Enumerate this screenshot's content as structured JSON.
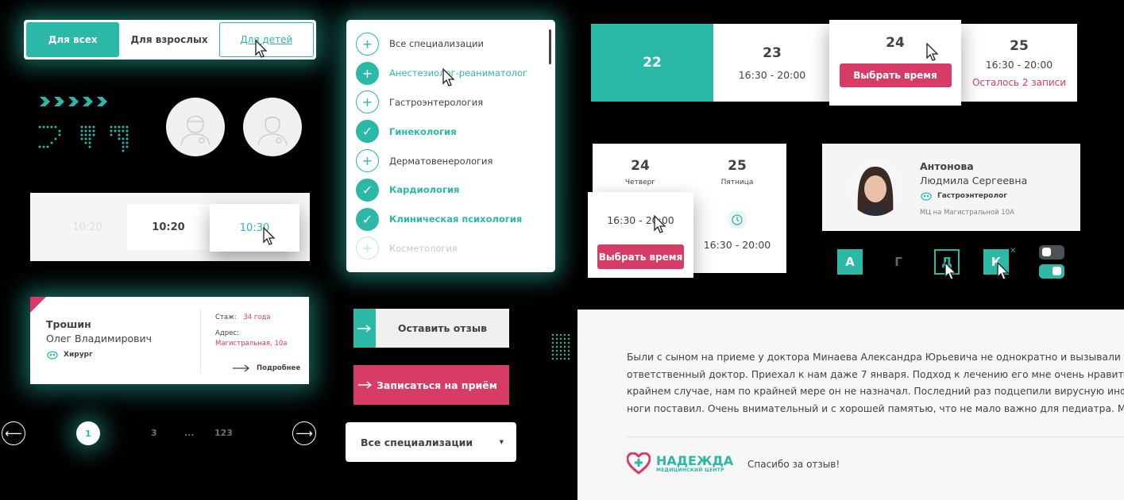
{
  "colors": {
    "accent": "#2cb8a7",
    "pink": "#d63c66",
    "text": "#3c4448"
  },
  "tabs": [
    "Для всех",
    "Для взрослых",
    "Для детей"
  ],
  "time_slots": [
    "10:20",
    "10:20",
    "10:30"
  ],
  "specializations": [
    {
      "label": "Все специализации",
      "state": "plus"
    },
    {
      "label": "Анестезиолог-реаниматолог",
      "state": "hover"
    },
    {
      "label": "Гастроэнтерология",
      "state": "plus"
    },
    {
      "label": "Гинекология",
      "state": "checked"
    },
    {
      "label": "Дерматовенерология",
      "state": "plus"
    },
    {
      "label": "Кардиология",
      "state": "checked"
    },
    {
      "label": "Клиническая психология",
      "state": "checked"
    },
    {
      "label": "Косметология",
      "state": "faded"
    }
  ],
  "dates": {
    "d22": "22",
    "d23": "23",
    "d23_time": "16:30 - 20:00",
    "d24": "24",
    "d24_button": "Выбрать время",
    "d25": "25",
    "d25_time": "16:30 - 20:00",
    "d25_note": "Осталось 2 записи"
  },
  "schedule": {
    "day1": "24",
    "day1_name": "Четверг",
    "day2": "25",
    "day2_name": "Пятница",
    "time1": "16:30 - 20:00",
    "button": "Выбрать время",
    "time2": "16:30 - 20:00"
  },
  "doctor_card": {
    "last_name": "Антонова",
    "first_names": "Людмила Сергеевна",
    "specialty": "Гастроэнтеролог",
    "clinic": "МЦ на Магистральной 10А"
  },
  "letters": [
    "А",
    "Г",
    "Д",
    "К"
  ],
  "doctor_card2": {
    "last_name": "Трошин",
    "first_names": "Олег Владимирович",
    "specialty": "Хирург",
    "exp_label": "Стаж:",
    "exp_value": "34 года",
    "addr_label": "Адрес:",
    "addr_value": "Магистральная, 10а",
    "more": "Подробнее"
  },
  "buttons": {
    "review": "Оставить отзыв",
    "signup": "Записаться на приём",
    "select": "Все специализации"
  },
  "pagination": [
    "1",
    "3",
    "...",
    "123"
  ],
  "review": {
    "lines": [
      "Были с сыном на приеме у доктора Минаева Александра Юрьевича не однократно и вызывали его домой",
      "ответственный доктор. Приехал к нам даже 7 января. Подход к лечению его мне очень нравится, антибио",
      "крайнем случае, нам по крайней мере он не назначал. Последний раз подцепили вирусную инфекцию, он",
      "ноги поставил. Очень внимательный и с хорошей памятью, что не мало важно для педиатра. Мы довольны"
    ],
    "brand": "НАДЕЖДА",
    "brand_sub": "МЕДИЦИНСКИЙ ЦЕНТР",
    "thanks": "Спасибо за отзыв!"
  }
}
